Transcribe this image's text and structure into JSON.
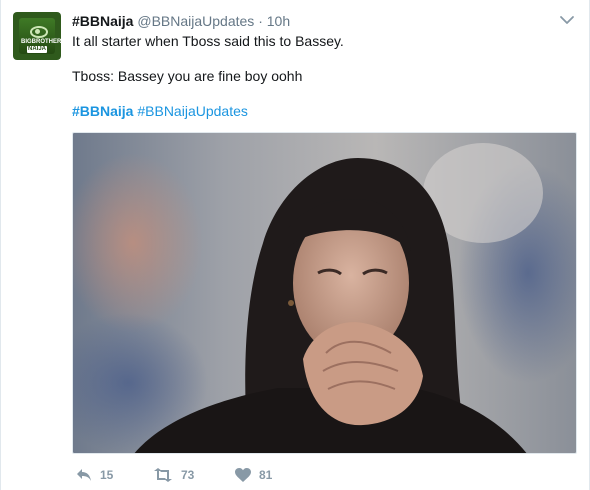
{
  "tweet": {
    "display_name": "#BBNaija",
    "handle": "@BBNaijaUpdates",
    "separator": "·",
    "time": "10h",
    "line1": "It all starter when Tboss said this to Bassey.",
    "line2": "Tboss: Bassey you are fine boy oohh",
    "hashtag1": "#BBNaija",
    "hashtag2": "#BBNaijaUpdates",
    "avatar_text_top": "BIGBROTHER",
    "avatar_text_bottom": "NAIJA"
  },
  "actions": {
    "reply_count": "15",
    "retweet_count": "73",
    "like_count": "81"
  },
  "colors": {
    "link": "#1b95e0",
    "muted": "#657786",
    "action": "#8899a6"
  },
  "icons": [
    "chevron-down-icon",
    "reply-icon",
    "retweet-icon",
    "heart-icon"
  ]
}
